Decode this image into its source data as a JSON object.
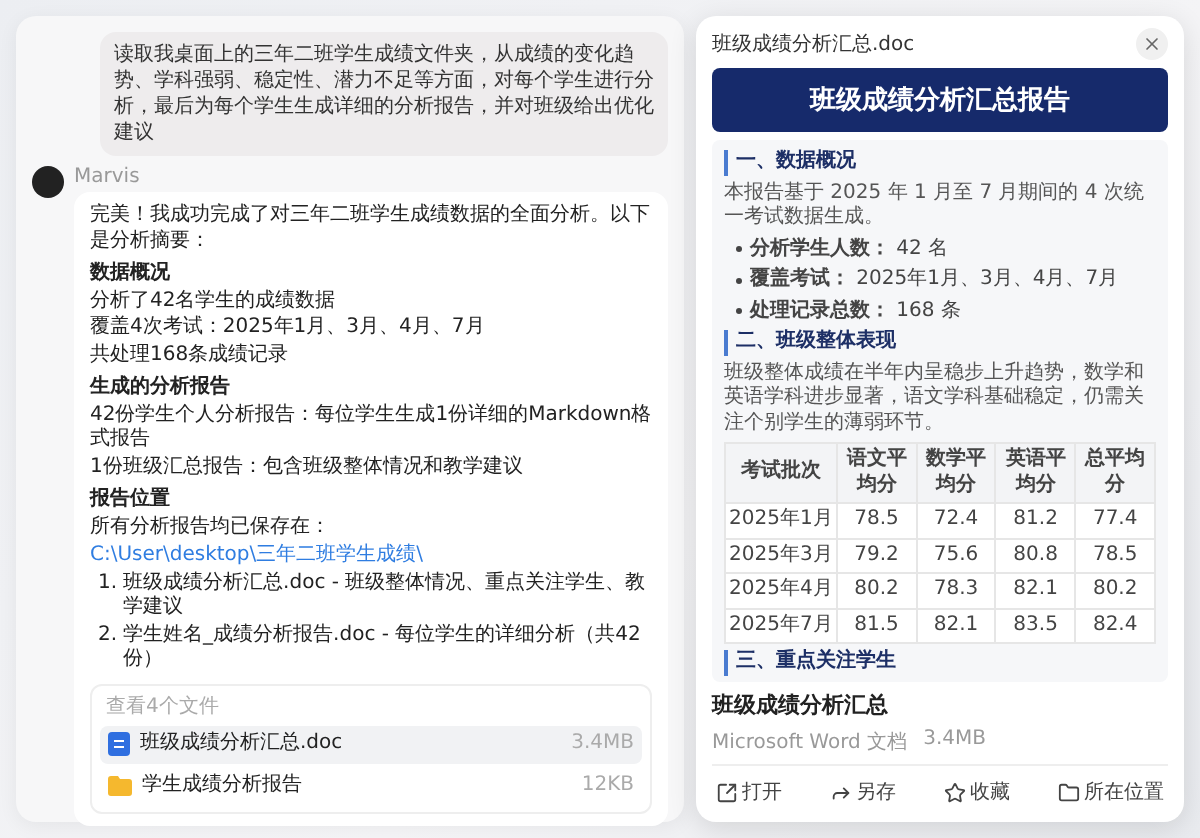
{
  "user_message": "读取我桌面上的三年二班学生成绩文件夹，从成绩的变化趋势、学科强弱、稳定性、潜力不足等方面，对每个学生进行分析，最后为每个学生生成详细的分析报告，并对班级给出优化建议",
  "assistant": {
    "name": "Marvis",
    "blocks": [
      {
        "kind": "para",
        "text": "完美！我成功完成了对三年二班学生成绩数据的全面分析。以下是分析摘要："
      },
      {
        "kind": "heading",
        "text": "数据概况"
      },
      {
        "kind": "line",
        "text": "分析了42名学生的成绩数据"
      },
      {
        "kind": "line",
        "text": "覆盖4次考试：2025年1月、3月、4月、7月"
      },
      {
        "kind": "line",
        "text": "共处理168条成绩记录"
      },
      {
        "kind": "heading",
        "text": "生成的分析报告"
      },
      {
        "kind": "line",
        "text": "42份学生个人分析报告：每位学生生成1份详细的Markdown格式报告"
      },
      {
        "kind": "line",
        "text": "1份班级汇总报告：包含班级整体情况和教学建议"
      },
      {
        "kind": "heading",
        "text": "报告位置"
      },
      {
        "kind": "path",
        "text": "所有分析报告均已保存在：",
        "link": "C:\\User\\desktop\\三年二班学生成绩\\"
      },
      {
        "kind": "list_item",
        "marker": "1.",
        "text": "班级成绩分析汇总.doc - 班级整体情况、重点关注学生、教学建议"
      },
      {
        "kind": "list_item",
        "marker": "2.",
        "text": "学生姓名_成绩分析报告.doc - 每位学生的详细分析（共42份）"
      }
    ]
  },
  "files": {
    "title": "查看4个文件",
    "items": [
      {
        "kind": "doc",
        "name": "班级成绩分析汇总.doc",
        "size": "3.4MB",
        "selected": true
      },
      {
        "kind": "folder",
        "name": "学生成绩分析报告",
        "size": "12KB",
        "selected": false
      }
    ]
  },
  "preview": {
    "title": "班级成绩分析汇总.doc",
    "banner": "班级成绩分析汇总报告",
    "sections": [
      {
        "heading": "一、数据概况",
        "text": "本报告基于 2025 年 1 月至 7 月期间的 4 次统一考试数据生成。",
        "bullets": [
          "**分析学生人数：** 42 名",
          "**覆盖考试：** 2025年1月、3月、4月、7月",
          "**处理记录总数：** 168 条"
        ]
      },
      {
        "heading": "二、班级整体表现",
        "text": "班级整体成绩在半年内呈稳步上升趋势，数学和英语学科进步显著，语文学科基础稳定，仍需关注个别学生的薄弱环节。",
        "table": {
          "columns": [
            "考试批次",
            "语文平均分",
            "数学平均分",
            "英语平均分",
            "总平均分"
          ],
          "rows": [
            [
              "2025年1月",
              "78.5",
              "72.4",
              "81.2",
              "77.4"
            ],
            [
              "2025年3月",
              "79.2",
              "75.6",
              "80.8",
              "78.5"
            ],
            [
              "2025年4月",
              "80.2",
              "78.3",
              "82.1",
              "80.2"
            ],
            [
              "2025年7月",
              "81.5",
              "82.1",
              "83.5",
              "82.4"
            ]
          ]
        }
      },
      {
        "heading": "三、重点关注学生"
      }
    ],
    "file_title": "班级成绩分析汇总",
    "file_type": "Microsoft Word 文档",
    "file_size": "3.4MB",
    "actions": [
      {
        "kind": "open",
        "label": "打开"
      },
      {
        "kind": "share",
        "label": "另存"
      },
      {
        "kind": "star",
        "label": "收藏"
      },
      {
        "kind": "folder",
        "label": "所在位置"
      }
    ]
  }
}
